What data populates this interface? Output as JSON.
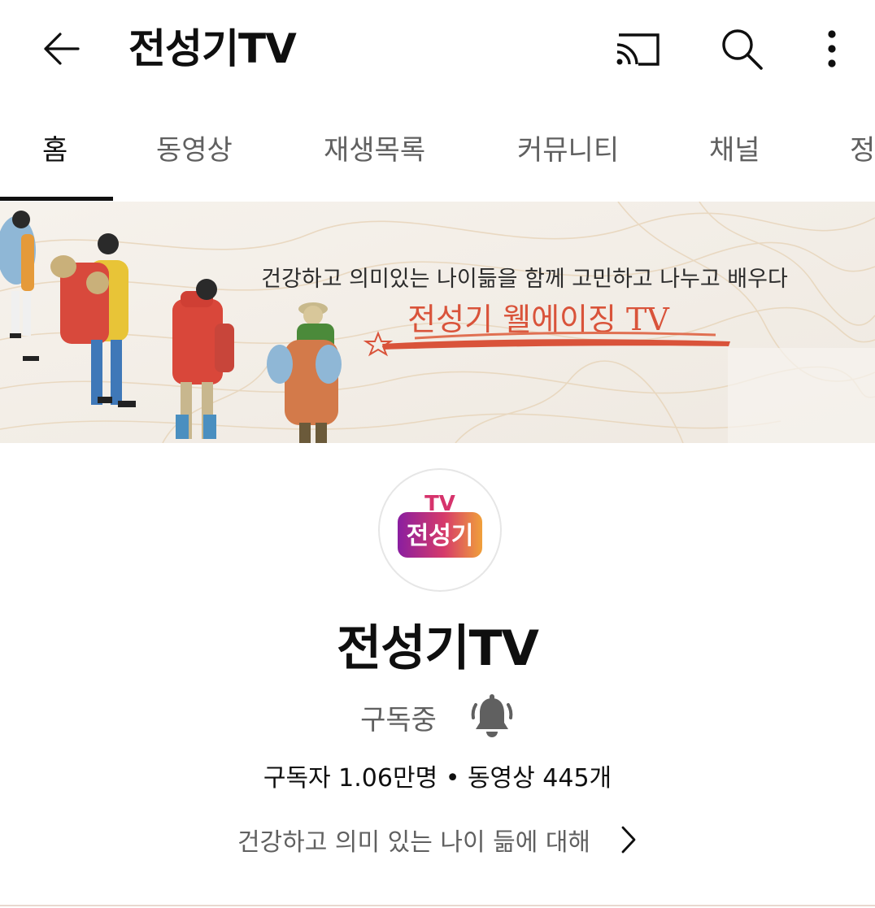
{
  "header": {
    "title": "전성기TV",
    "back_icon": "arrow-left-icon",
    "cast_icon": "cast-icon",
    "search_icon": "search-icon",
    "more_icon": "more-vertical-icon"
  },
  "tabs": [
    {
      "label": "홈",
      "active": true
    },
    {
      "label": "동영상",
      "active": false
    },
    {
      "label": "재생목록",
      "active": false
    },
    {
      "label": "커뮤니티",
      "active": false
    },
    {
      "label": "채널",
      "active": false
    },
    {
      "label": "정",
      "active": false
    }
  ],
  "banner": {
    "tagline": "건강하고 의미있는 나이듦을 함께 고민하고 나누고 배우다",
    "brand": "전성기 웰에이징 TV"
  },
  "channel": {
    "avatar_top": "TV",
    "avatar_text": "전성기",
    "name": "전성기TV",
    "subscribed_label": "구독중",
    "bell_icon": "bell-icon",
    "stats": "구독자 1.06만명 • 동영상 445개",
    "about": "건강하고 의미 있는 나이 듦에 대해",
    "about_icon": "chevron-right-icon"
  },
  "colors": {
    "text_primary": "#0f0f0f",
    "text_secondary": "#606060",
    "brand_red": "#d9533a",
    "avatar_gradient_start": "#8a1ea0",
    "avatar_gradient_end": "#f0a03a"
  }
}
